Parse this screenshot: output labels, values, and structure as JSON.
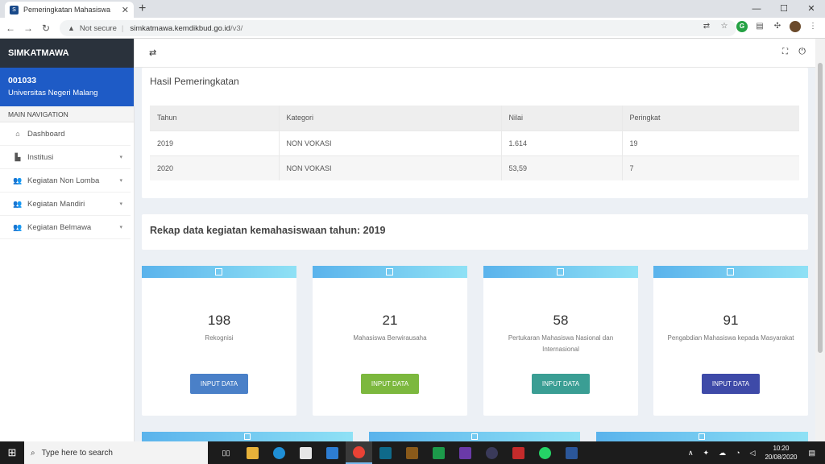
{
  "browser": {
    "tab_title": "Pemeringkatan Mahasiswa",
    "tab_close": "✕",
    "new_tab": "+",
    "security": "Not secure",
    "url_host": "simkatmawa.kemdikbud.go.id",
    "url_path": "/v3/",
    "controls": {
      "minimize": "—",
      "maximize": "☐",
      "close": "✕"
    }
  },
  "sidebar": {
    "brand": "SIMKATMAWA",
    "user_id": "001033",
    "user_name": "Universitas Negeri Malang",
    "section": "MAIN NAVIGATION",
    "items": [
      {
        "label": "Dashboard",
        "icon": "home-icon"
      },
      {
        "label": "Institusi",
        "icon": "building-icon"
      },
      {
        "label": "Kegiatan Non Lomba",
        "icon": "users-icon"
      },
      {
        "label": "Kegiatan Mandiri",
        "icon": "users-icon"
      },
      {
        "label": "Kegiatan Belmawa",
        "icon": "users-icon"
      }
    ]
  },
  "ranking": {
    "title": "Hasil Pemeringkatan",
    "columns": [
      "Tahun",
      "Kategori",
      "Nilai",
      "Peringkat"
    ],
    "rows": [
      [
        "2019",
        "NON VOKASI",
        "1.614",
        "19"
      ],
      [
        "2020",
        "NON VOKASI",
        "53,59",
        "7"
      ]
    ]
  },
  "recap": {
    "title": "Rekap data kegiatan kemahasiswaan tahun: 2019"
  },
  "stats": [
    {
      "value": "198",
      "label": "Rekognisi",
      "button": "INPUT DATA",
      "color": "#4a80c8"
    },
    {
      "value": "21",
      "label": "Mahasiswa Berwirausaha",
      "button": "INPUT DATA",
      "color": "#7cb83e"
    },
    {
      "value": "58",
      "label": "Pertukaran Mahasiswa Nasional dan Internasional",
      "button": "INPUT DATA",
      "color": "#3a9e94"
    },
    {
      "value": "91",
      "label": "Pengabdian Mahasiswa kepada Masyarakat",
      "button": "INPUT DATA",
      "color": "#3e4aa8"
    }
  ],
  "taskbar": {
    "search_placeholder": "Type here to search",
    "time": "10:20",
    "date": "20/08/2020"
  }
}
